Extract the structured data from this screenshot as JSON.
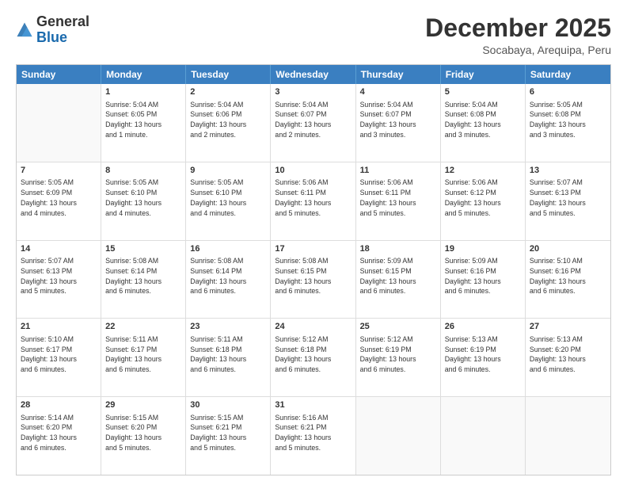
{
  "logo": {
    "general": "General",
    "blue": "Blue"
  },
  "title": "December 2025",
  "location": "Socabaya, Arequipa, Peru",
  "days_of_week": [
    "Sunday",
    "Monday",
    "Tuesday",
    "Wednesday",
    "Thursday",
    "Friday",
    "Saturday"
  ],
  "weeks": [
    [
      {
        "day": "",
        "info": ""
      },
      {
        "day": "1",
        "info": "Sunrise: 5:04 AM\nSunset: 6:05 PM\nDaylight: 13 hours\nand 1 minute."
      },
      {
        "day": "2",
        "info": "Sunrise: 5:04 AM\nSunset: 6:06 PM\nDaylight: 13 hours\nand 2 minutes."
      },
      {
        "day": "3",
        "info": "Sunrise: 5:04 AM\nSunset: 6:07 PM\nDaylight: 13 hours\nand 2 minutes."
      },
      {
        "day": "4",
        "info": "Sunrise: 5:04 AM\nSunset: 6:07 PM\nDaylight: 13 hours\nand 3 minutes."
      },
      {
        "day": "5",
        "info": "Sunrise: 5:04 AM\nSunset: 6:08 PM\nDaylight: 13 hours\nand 3 minutes."
      },
      {
        "day": "6",
        "info": "Sunrise: 5:05 AM\nSunset: 6:08 PM\nDaylight: 13 hours\nand 3 minutes."
      }
    ],
    [
      {
        "day": "7",
        "info": "Sunrise: 5:05 AM\nSunset: 6:09 PM\nDaylight: 13 hours\nand 4 minutes."
      },
      {
        "day": "8",
        "info": "Sunrise: 5:05 AM\nSunset: 6:10 PM\nDaylight: 13 hours\nand 4 minutes."
      },
      {
        "day": "9",
        "info": "Sunrise: 5:05 AM\nSunset: 6:10 PM\nDaylight: 13 hours\nand 4 minutes."
      },
      {
        "day": "10",
        "info": "Sunrise: 5:06 AM\nSunset: 6:11 PM\nDaylight: 13 hours\nand 5 minutes."
      },
      {
        "day": "11",
        "info": "Sunrise: 5:06 AM\nSunset: 6:11 PM\nDaylight: 13 hours\nand 5 minutes."
      },
      {
        "day": "12",
        "info": "Sunrise: 5:06 AM\nSunset: 6:12 PM\nDaylight: 13 hours\nand 5 minutes."
      },
      {
        "day": "13",
        "info": "Sunrise: 5:07 AM\nSunset: 6:13 PM\nDaylight: 13 hours\nand 5 minutes."
      }
    ],
    [
      {
        "day": "14",
        "info": "Sunrise: 5:07 AM\nSunset: 6:13 PM\nDaylight: 13 hours\nand 5 minutes."
      },
      {
        "day": "15",
        "info": "Sunrise: 5:08 AM\nSunset: 6:14 PM\nDaylight: 13 hours\nand 6 minutes."
      },
      {
        "day": "16",
        "info": "Sunrise: 5:08 AM\nSunset: 6:14 PM\nDaylight: 13 hours\nand 6 minutes."
      },
      {
        "day": "17",
        "info": "Sunrise: 5:08 AM\nSunset: 6:15 PM\nDaylight: 13 hours\nand 6 minutes."
      },
      {
        "day": "18",
        "info": "Sunrise: 5:09 AM\nSunset: 6:15 PM\nDaylight: 13 hours\nand 6 minutes."
      },
      {
        "day": "19",
        "info": "Sunrise: 5:09 AM\nSunset: 6:16 PM\nDaylight: 13 hours\nand 6 minutes."
      },
      {
        "day": "20",
        "info": "Sunrise: 5:10 AM\nSunset: 6:16 PM\nDaylight: 13 hours\nand 6 minutes."
      }
    ],
    [
      {
        "day": "21",
        "info": "Sunrise: 5:10 AM\nSunset: 6:17 PM\nDaylight: 13 hours\nand 6 minutes."
      },
      {
        "day": "22",
        "info": "Sunrise: 5:11 AM\nSunset: 6:17 PM\nDaylight: 13 hours\nand 6 minutes."
      },
      {
        "day": "23",
        "info": "Sunrise: 5:11 AM\nSunset: 6:18 PM\nDaylight: 13 hours\nand 6 minutes."
      },
      {
        "day": "24",
        "info": "Sunrise: 5:12 AM\nSunset: 6:18 PM\nDaylight: 13 hours\nand 6 minutes."
      },
      {
        "day": "25",
        "info": "Sunrise: 5:12 AM\nSunset: 6:19 PM\nDaylight: 13 hours\nand 6 minutes."
      },
      {
        "day": "26",
        "info": "Sunrise: 5:13 AM\nSunset: 6:19 PM\nDaylight: 13 hours\nand 6 minutes."
      },
      {
        "day": "27",
        "info": "Sunrise: 5:13 AM\nSunset: 6:20 PM\nDaylight: 13 hours\nand 6 minutes."
      }
    ],
    [
      {
        "day": "28",
        "info": "Sunrise: 5:14 AM\nSunset: 6:20 PM\nDaylight: 13 hours\nand 6 minutes."
      },
      {
        "day": "29",
        "info": "Sunrise: 5:15 AM\nSunset: 6:20 PM\nDaylight: 13 hours\nand 5 minutes."
      },
      {
        "day": "30",
        "info": "Sunrise: 5:15 AM\nSunset: 6:21 PM\nDaylight: 13 hours\nand 5 minutes."
      },
      {
        "day": "31",
        "info": "Sunrise: 5:16 AM\nSunset: 6:21 PM\nDaylight: 13 hours\nand 5 minutes."
      },
      {
        "day": "",
        "info": ""
      },
      {
        "day": "",
        "info": ""
      },
      {
        "day": "",
        "info": ""
      }
    ]
  ]
}
